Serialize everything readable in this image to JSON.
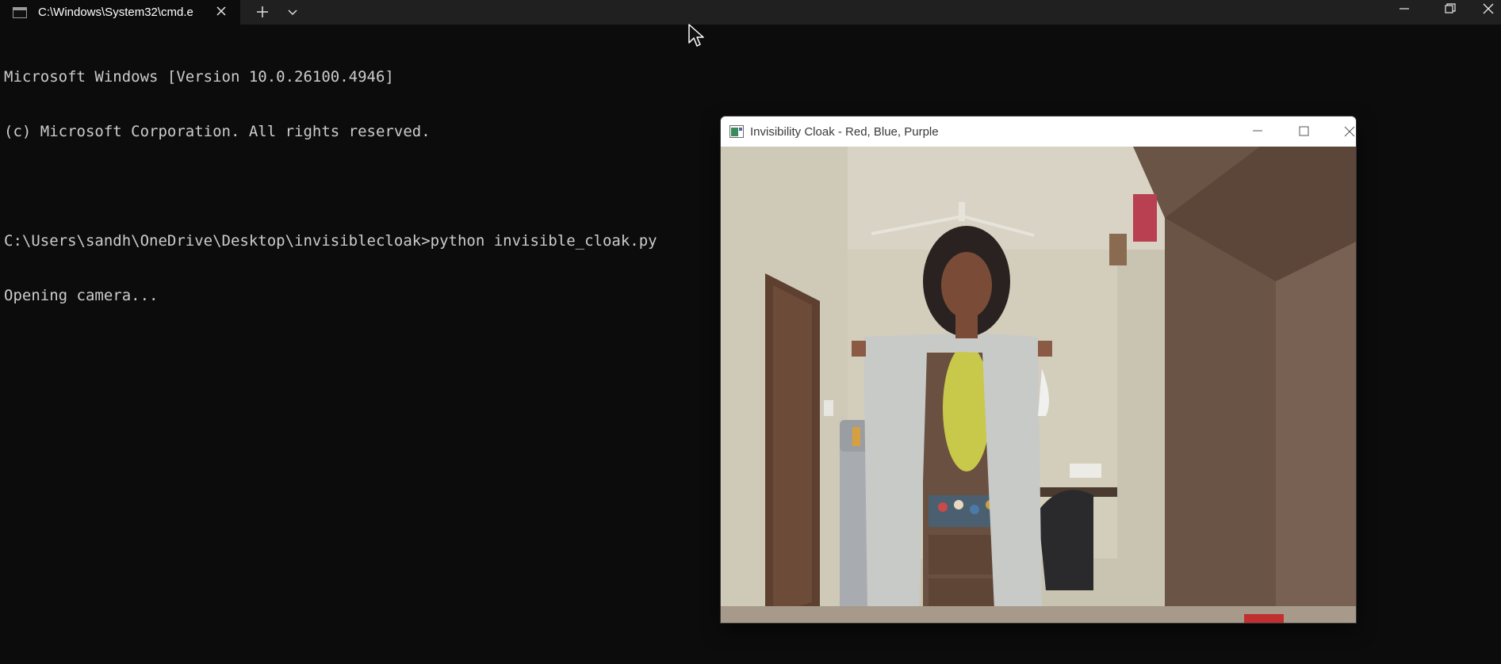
{
  "terminal": {
    "tab_title": "C:\\Windows\\System32\\cmd.e",
    "lines": [
      "Microsoft Windows [Version 10.0.26100.4946]",
      "(c) Microsoft Corporation. All rights reserved.",
      "",
      "C:\\Users\\sandh\\OneDrive\\Desktop\\invisiblecloak>python invisible_cloak.py",
      "Opening camera..."
    ],
    "colors": {
      "background": "#0c0c0c",
      "titlebar": "#202020",
      "text": "#cccccc"
    },
    "icons": {
      "tab": "terminal-icon",
      "close": "close-icon",
      "new_tab": "plus-icon",
      "dropdown": "chevron-down-icon",
      "minimize": "minimize-icon",
      "restore": "restore-icon",
      "window_close": "close-icon"
    }
  },
  "camera_window": {
    "title": "Invisibility Cloak - Red, Blue, Purple",
    "icons": {
      "app": "image-window-icon",
      "minimize": "minimize-icon",
      "maximize": "maximize-icon",
      "close": "close-icon"
    },
    "frame": "webcam-frame-room-with-person-holding-cloak"
  }
}
